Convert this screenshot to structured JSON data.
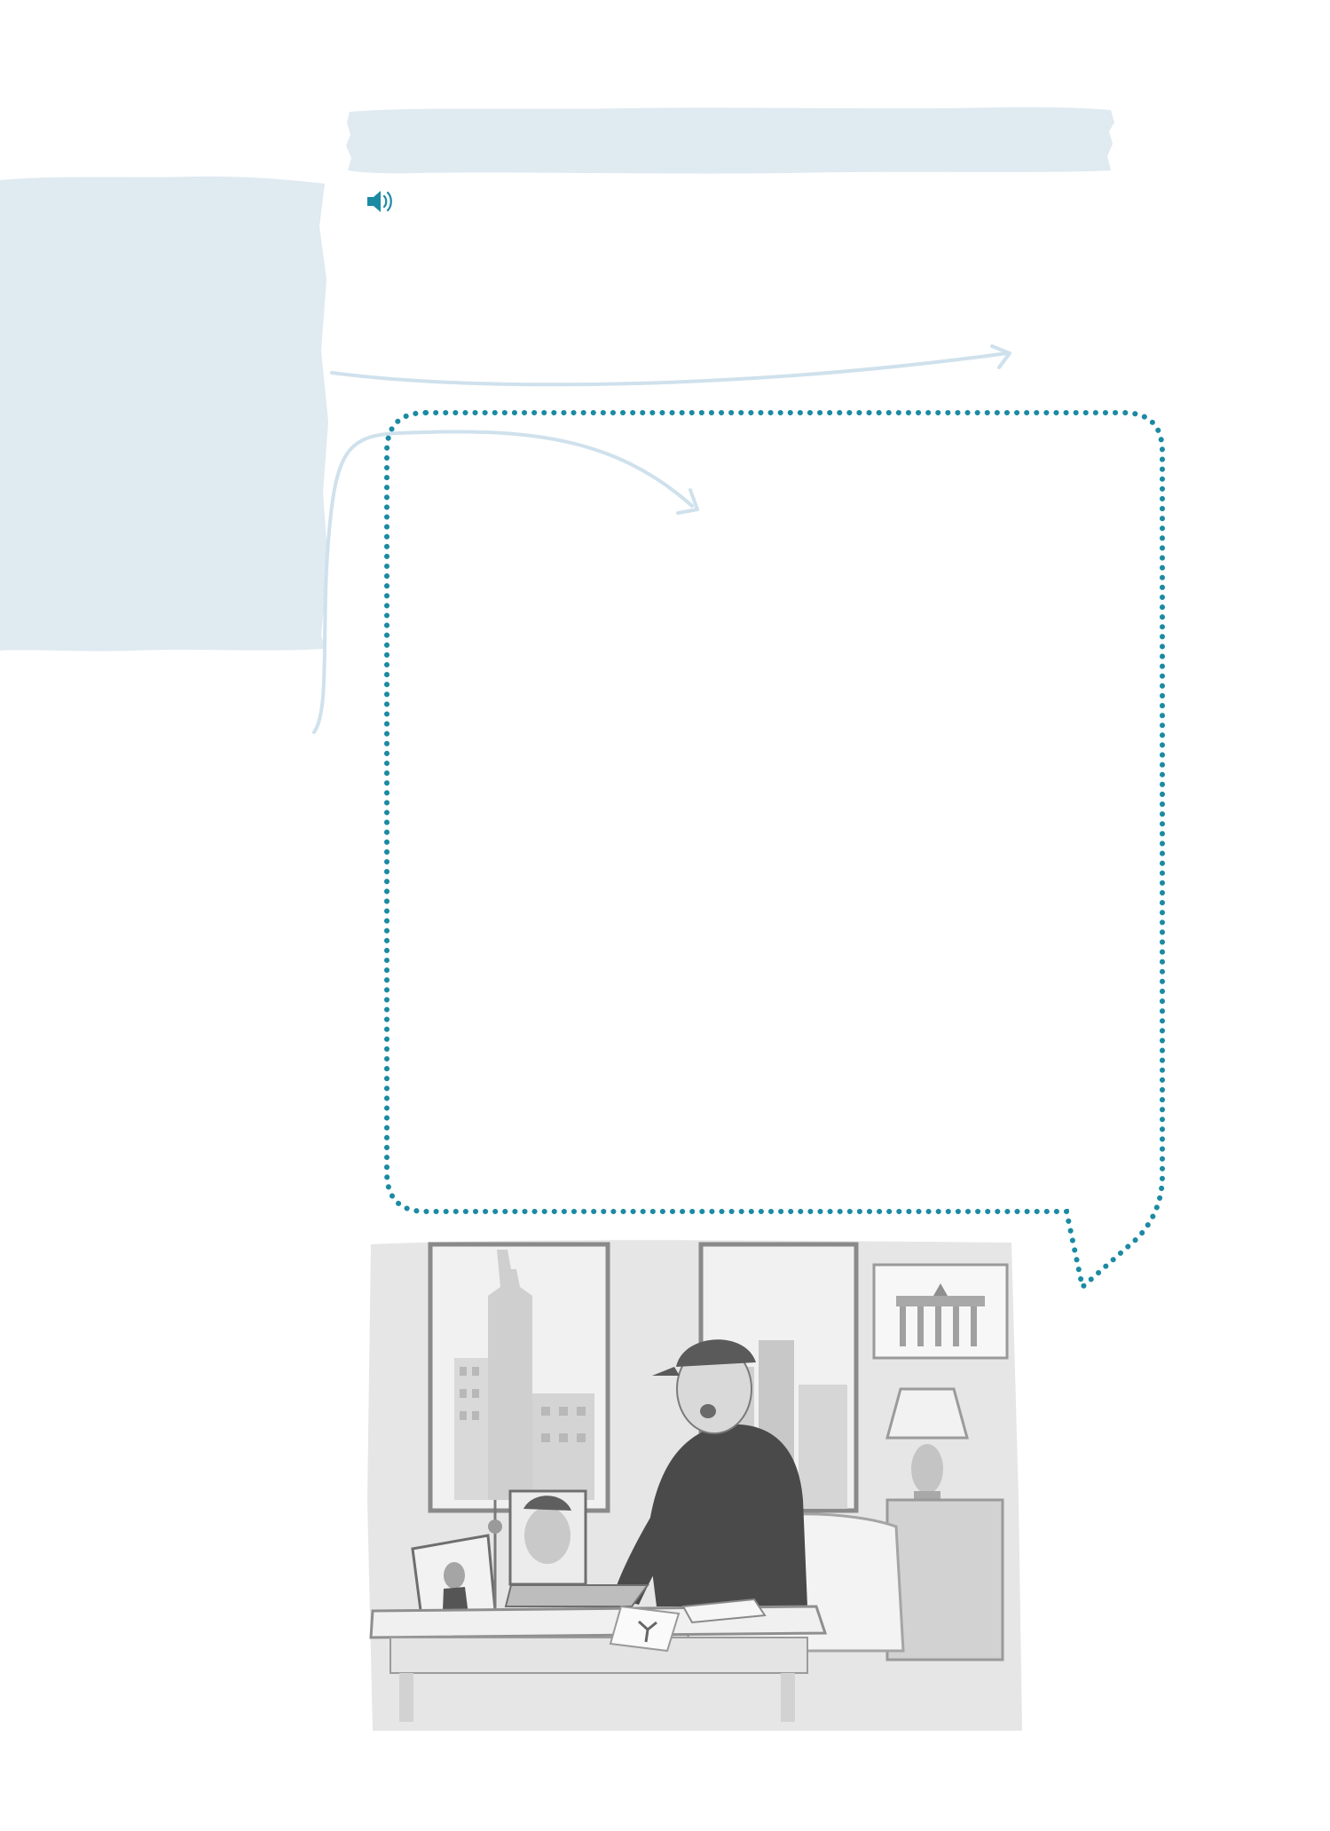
{
  "header": {
    "title": ""
  },
  "audio": {
    "icon": "speaker-icon",
    "accent_color": "#1b8aa3"
  },
  "side_panel": {
    "text": ""
  },
  "speech_bubble": {
    "text": "",
    "border_color": "#1b8aa3"
  },
  "illustration": {
    "description_icon": "man-video-call-illustration"
  },
  "colors": {
    "panel_blue": "#dfeaf1",
    "arrow_blue": "#cfe1ec",
    "dot_teal": "#1b8aa3"
  }
}
